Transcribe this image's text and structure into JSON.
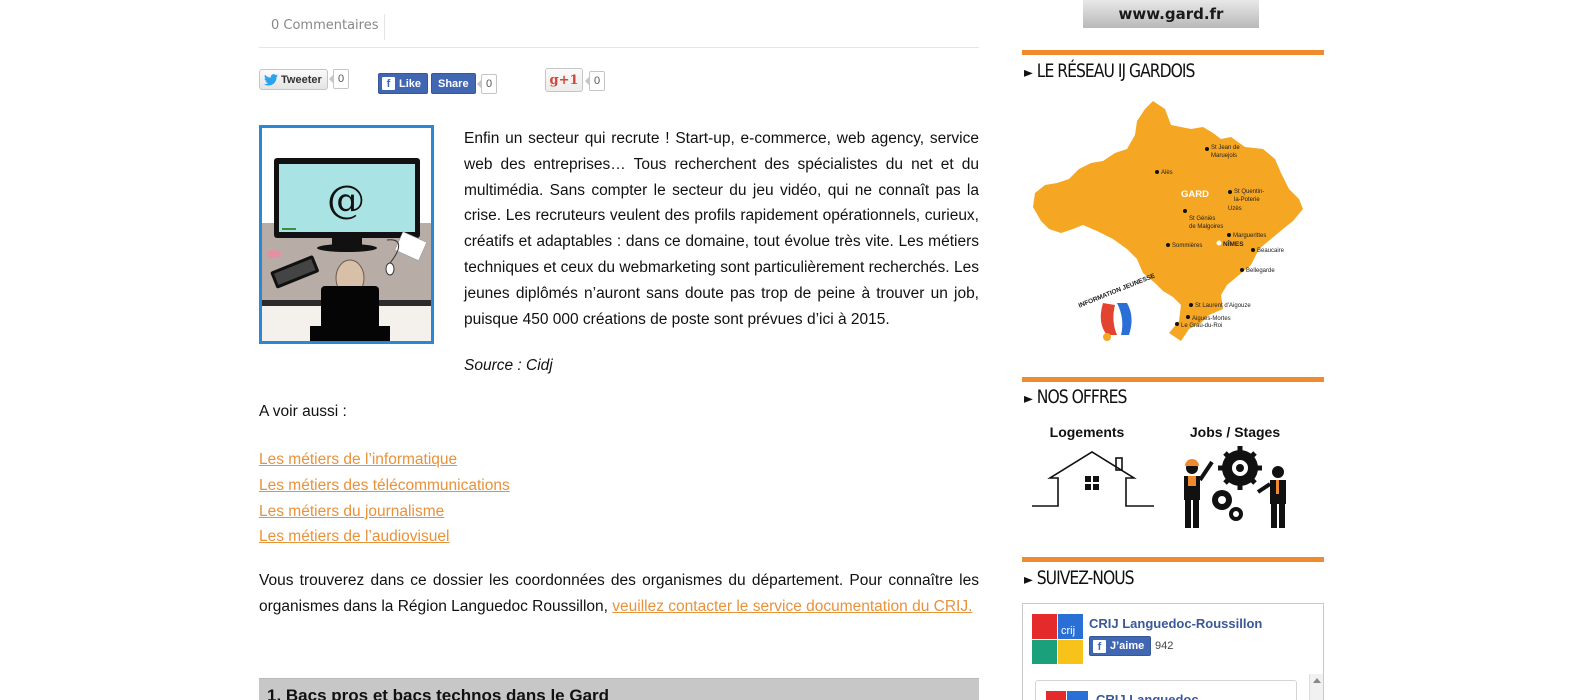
{
  "article": {
    "comments_label": "0 Commentaires",
    "share": {
      "tweet_label": "Tweeter",
      "tweet_count": "0",
      "fb_like_label": "Like",
      "fb_share_label": "Share",
      "fb_count": "0",
      "gplus_label": "g+1",
      "gplus_count": "0"
    },
    "thumbnail_at": "@",
    "intro": "Enfin un secteur qui recrute ! Start-up, e-commerce, web agency, service web des entreprises… Tous recherchent des spécialistes du net et du multimédia. Sans compter le secteur du jeu vidéo, qui ne connaît pas la crise. Les recruteurs veulent des profils rapidement opérationnels, curieux, créatifs et adaptables : dans ce domaine, tout évolue très vite. Les métiers techniques et ceux du webmarketing sont particulièrement recherchés. Les jeunes diplômés n’auront sans doute pas trop de peine à trouver un job, puisque 450 000 créations de poste sont prévues d’ici à 2015.",
    "source": "Source : Cidj",
    "see_also": "A voir aussi :",
    "links": [
      "Les métiers de l’informatique",
      "Les métiers des télécommunications",
      "Les métiers du journalisme",
      "Les métiers de l’audiovisuel"
    ],
    "outro_text": "Vous trouverez dans ce dossier les coordonnées des organismes du département. Pour connaître les organismes dans la Région Languedoc Roussillon, ",
    "outro_link": "veuillez contacter le service documentation du CRIJ.",
    "section_title": "1.   Bacs pros et bacs technos dans le Gard"
  },
  "sidebar": {
    "banner": "www.gard.fr",
    "widgets": {
      "reseau": "LE RÉSEAU IJ GARDOIS",
      "offres": "NOS OFFRES",
      "suivez": "SUIVEZ-NOUS"
    },
    "map": {
      "region_label": "GARD",
      "logo_text": "INFORMATION JEUNESSE",
      "towns": [
        "St Jean de",
        "Maruejols",
        "Alès",
        "St Quentin-",
        "la-Poterie",
        "Uzès",
        "St Géniès",
        "de Malgoires",
        "Marguerittes",
        "Sommières",
        "NÎMES",
        "Beaucaire",
        "Bellegarde",
        "St Laurent d’Aigouze",
        "Aigues-Mortes",
        "Le Grau-du-Roi"
      ]
    },
    "offers": [
      {
        "label": "Logements",
        "icon": "house-icon"
      },
      {
        "label": "Jobs / Stages",
        "icon": "workers-gears-icon"
      }
    ],
    "facebook": {
      "page_name": "CRIJ Languedoc-Roussillon",
      "logo_text": "crij",
      "like_label": "J’aime",
      "like_count": "942",
      "inner_name": "CRIJ Languedoc"
    }
  },
  "colors": {
    "accent_orange": "#f08a2e",
    "link_orange": "#e8923a",
    "map_yellow": "#f5a623",
    "facebook_blue": "#4267b2",
    "thumb_border": "#2a87d4"
  }
}
